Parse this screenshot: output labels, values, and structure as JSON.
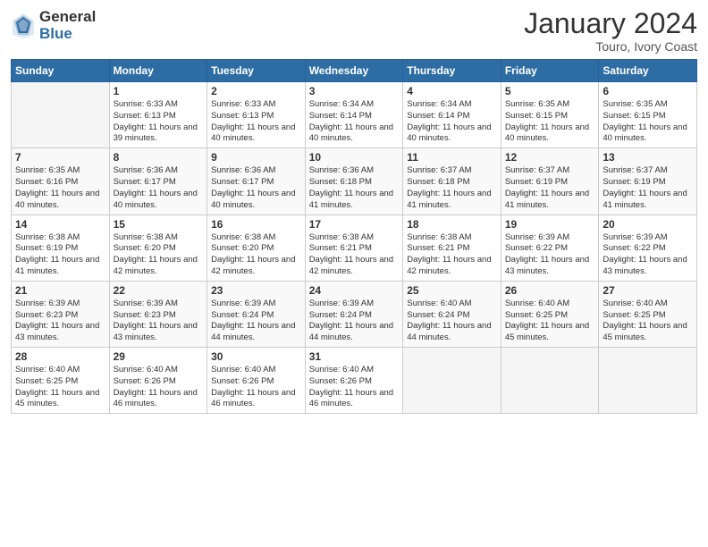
{
  "logo": {
    "general": "General",
    "blue": "Blue"
  },
  "title": "January 2024",
  "subtitle": "Touro, Ivory Coast",
  "weekdays": [
    "Sunday",
    "Monday",
    "Tuesday",
    "Wednesday",
    "Thursday",
    "Friday",
    "Saturday"
  ],
  "weeks": [
    [
      {
        "day": "",
        "info": ""
      },
      {
        "day": "1",
        "info": "Sunrise: 6:33 AM\nSunset: 6:13 PM\nDaylight: 11 hours\nand 39 minutes."
      },
      {
        "day": "2",
        "info": "Sunrise: 6:33 AM\nSunset: 6:13 PM\nDaylight: 11 hours\nand 40 minutes."
      },
      {
        "day": "3",
        "info": "Sunrise: 6:34 AM\nSunset: 6:14 PM\nDaylight: 11 hours\nand 40 minutes."
      },
      {
        "day": "4",
        "info": "Sunrise: 6:34 AM\nSunset: 6:14 PM\nDaylight: 11 hours\nand 40 minutes."
      },
      {
        "day": "5",
        "info": "Sunrise: 6:35 AM\nSunset: 6:15 PM\nDaylight: 11 hours\nand 40 minutes."
      },
      {
        "day": "6",
        "info": "Sunrise: 6:35 AM\nSunset: 6:15 PM\nDaylight: 11 hours\nand 40 minutes."
      }
    ],
    [
      {
        "day": "7",
        "info": "Sunrise: 6:35 AM\nSunset: 6:16 PM\nDaylight: 11 hours\nand 40 minutes."
      },
      {
        "day": "8",
        "info": "Sunrise: 6:36 AM\nSunset: 6:17 PM\nDaylight: 11 hours\nand 40 minutes."
      },
      {
        "day": "9",
        "info": "Sunrise: 6:36 AM\nSunset: 6:17 PM\nDaylight: 11 hours\nand 40 minutes."
      },
      {
        "day": "10",
        "info": "Sunrise: 6:36 AM\nSunset: 6:18 PM\nDaylight: 11 hours\nand 41 minutes."
      },
      {
        "day": "11",
        "info": "Sunrise: 6:37 AM\nSunset: 6:18 PM\nDaylight: 11 hours\nand 41 minutes."
      },
      {
        "day": "12",
        "info": "Sunrise: 6:37 AM\nSunset: 6:19 PM\nDaylight: 11 hours\nand 41 minutes."
      },
      {
        "day": "13",
        "info": "Sunrise: 6:37 AM\nSunset: 6:19 PM\nDaylight: 11 hours\nand 41 minutes."
      }
    ],
    [
      {
        "day": "14",
        "info": "Sunrise: 6:38 AM\nSunset: 6:19 PM\nDaylight: 11 hours\nand 41 minutes."
      },
      {
        "day": "15",
        "info": "Sunrise: 6:38 AM\nSunset: 6:20 PM\nDaylight: 11 hours\nand 42 minutes."
      },
      {
        "day": "16",
        "info": "Sunrise: 6:38 AM\nSunset: 6:20 PM\nDaylight: 11 hours\nand 42 minutes."
      },
      {
        "day": "17",
        "info": "Sunrise: 6:38 AM\nSunset: 6:21 PM\nDaylight: 11 hours\nand 42 minutes."
      },
      {
        "day": "18",
        "info": "Sunrise: 6:38 AM\nSunset: 6:21 PM\nDaylight: 11 hours\nand 42 minutes."
      },
      {
        "day": "19",
        "info": "Sunrise: 6:39 AM\nSunset: 6:22 PM\nDaylight: 11 hours\nand 43 minutes."
      },
      {
        "day": "20",
        "info": "Sunrise: 6:39 AM\nSunset: 6:22 PM\nDaylight: 11 hours\nand 43 minutes."
      }
    ],
    [
      {
        "day": "21",
        "info": "Sunrise: 6:39 AM\nSunset: 6:23 PM\nDaylight: 11 hours\nand 43 minutes."
      },
      {
        "day": "22",
        "info": "Sunrise: 6:39 AM\nSunset: 6:23 PM\nDaylight: 11 hours\nand 43 minutes."
      },
      {
        "day": "23",
        "info": "Sunrise: 6:39 AM\nSunset: 6:24 PM\nDaylight: 11 hours\nand 44 minutes."
      },
      {
        "day": "24",
        "info": "Sunrise: 6:39 AM\nSunset: 6:24 PM\nDaylight: 11 hours\nand 44 minutes."
      },
      {
        "day": "25",
        "info": "Sunrise: 6:40 AM\nSunset: 6:24 PM\nDaylight: 11 hours\nand 44 minutes."
      },
      {
        "day": "26",
        "info": "Sunrise: 6:40 AM\nSunset: 6:25 PM\nDaylight: 11 hours\nand 45 minutes."
      },
      {
        "day": "27",
        "info": "Sunrise: 6:40 AM\nSunset: 6:25 PM\nDaylight: 11 hours\nand 45 minutes."
      }
    ],
    [
      {
        "day": "28",
        "info": "Sunrise: 6:40 AM\nSunset: 6:25 PM\nDaylight: 11 hours\nand 45 minutes."
      },
      {
        "day": "29",
        "info": "Sunrise: 6:40 AM\nSunset: 6:26 PM\nDaylight: 11 hours\nand 46 minutes."
      },
      {
        "day": "30",
        "info": "Sunrise: 6:40 AM\nSunset: 6:26 PM\nDaylight: 11 hours\nand 46 minutes."
      },
      {
        "day": "31",
        "info": "Sunrise: 6:40 AM\nSunset: 6:26 PM\nDaylight: 11 hours\nand 46 minutes."
      },
      {
        "day": "",
        "info": ""
      },
      {
        "day": "",
        "info": ""
      },
      {
        "day": "",
        "info": ""
      }
    ]
  ]
}
